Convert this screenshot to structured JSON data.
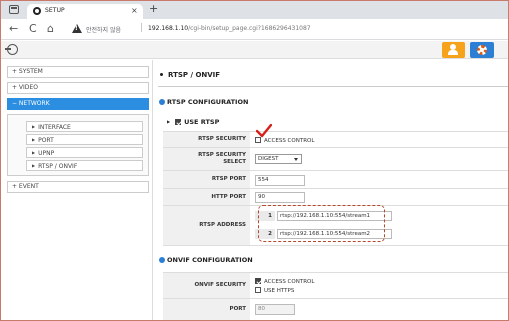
{
  "browser": {
    "tab_title": "SETUP",
    "tab_close": "×",
    "new_tab": "+",
    "nav_back": "←",
    "nav_reload": "C",
    "nav_home": "⌂",
    "insecure_label": "안전하지 않음",
    "url_host": "192.168.1.10",
    "url_path": "/cgi-bin/setup_page.cgi?1686296431087"
  },
  "app": {
    "icons": {
      "logout": "logout-icon",
      "user": "user-icon",
      "settings": "gear-icon"
    },
    "colors": {
      "accent": "#2b8ee0",
      "user_button": "#f7a21b",
      "settings_button": "#2b7fd4",
      "highlight": "#b5482a"
    }
  },
  "sidebar": {
    "items": [
      {
        "label": "+  SYSTEM"
      },
      {
        "label": "+  VIDEO"
      },
      {
        "label": "−  NETWORK",
        "active": true
      }
    ],
    "network_sub": [
      {
        "label": "INTERFACE"
      },
      {
        "label": "PORT"
      },
      {
        "label": "UPNP"
      },
      {
        "label": "RTSP / ONVIF"
      }
    ],
    "event": {
      "label": "+  EVENT"
    }
  },
  "main": {
    "page_title": "RTSP / ONVIF",
    "rtsp": {
      "section_title": "RTSP CONFIGURATION",
      "use_rtsp": "USE RTSP",
      "security_label": "RTSP SECURITY",
      "security_option": "ACCESS CONTROL",
      "select_label_1": "RTSP SECURITY",
      "select_label_2": "SELECT",
      "select_value": "DIGEST",
      "port_label": "RTSP PORT",
      "port_value": "554",
      "http_port_label": "HTTP PORT",
      "http_port_value": "90",
      "address_label": "RTSP ADDRESS",
      "addresses": [
        {
          "num": "1",
          "url": "rtsp://192.168.1.10:554/stream1"
        },
        {
          "num": "2",
          "url": "rtsp://192.168.1.10:554/stream2"
        }
      ]
    },
    "onvif": {
      "section_title": "ONVIF CONFIGURATION",
      "security_label": "ONVIF SECURITY",
      "access_control": "ACCESS CONTROL",
      "use_https": "USE HTTPS",
      "port_label": "PORT",
      "port_value": "80"
    }
  }
}
